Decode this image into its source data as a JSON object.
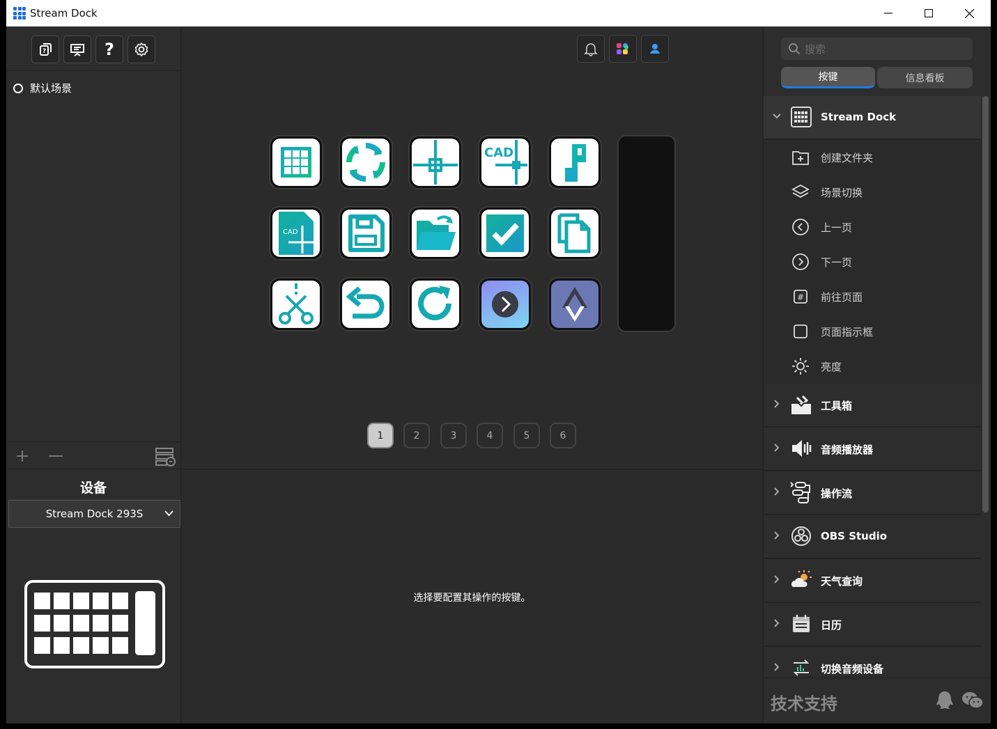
{
  "window": {
    "title": "Stream Dock"
  },
  "left": {
    "scene_label": "默认场景",
    "device_title": "设备",
    "device_selected": "Stream Dock 293S"
  },
  "center": {
    "pages": [
      "1",
      "2",
      "3",
      "4",
      "5",
      "6"
    ],
    "active_page": "1",
    "hint": "选择要配置其操作的按键。",
    "keys": [
      {
        "icon": "grid-icon"
      },
      {
        "icon": "refresh-ring-icon"
      },
      {
        "icon": "crosshair-icon"
      },
      {
        "icon": "cad-crosshair-icon",
        "text": "CAD"
      },
      {
        "icon": "flag-icon"
      },
      {
        "icon": "cad-file-icon",
        "text": "CAD"
      },
      {
        "icon": "save-icon"
      },
      {
        "icon": "open-folder-icon"
      },
      {
        "icon": "check-icon"
      },
      {
        "icon": "copy-icon"
      },
      {
        "icon": "scissors-icon"
      },
      {
        "icon": "undo-icon"
      },
      {
        "icon": "redo-icon"
      },
      {
        "icon": "next-page-icon"
      },
      {
        "icon": "page-up-down-icon"
      }
    ]
  },
  "right": {
    "search_placeholder": "搜索",
    "tabs": [
      "按键",
      "信息看板"
    ],
    "active_tab": "按键",
    "categories": [
      {
        "label": "Stream Dock",
        "expanded": true,
        "icon": "keypad-icon"
      },
      {
        "label": "工具箱",
        "icon": "toolbox-icon"
      },
      {
        "label": "音频播放器",
        "icon": "speaker-icon"
      },
      {
        "label": "操作流",
        "icon": "workflow-icon"
      },
      {
        "label": "OBS Studio",
        "icon": "obs-icon"
      },
      {
        "label": "天气查询",
        "icon": "weather-icon"
      },
      {
        "label": "日历",
        "icon": "calendar-icon"
      },
      {
        "label": "切换音频设备",
        "icon": "audio-device-icon"
      }
    ],
    "streamdock_items": [
      {
        "label": "创建文件夹",
        "icon": "folder-add-icon"
      },
      {
        "label": "场景切换",
        "icon": "layers-icon"
      },
      {
        "label": "上一页",
        "icon": "prev-circle-icon"
      },
      {
        "label": "下一页",
        "icon": "next-circle-icon"
      },
      {
        "label": "前往页面",
        "icon": "hash-icon"
      },
      {
        "label": "页面指示框",
        "icon": "square-icon"
      },
      {
        "label": "亮度",
        "icon": "sun-icon"
      }
    ],
    "support_label": "技术支持"
  },
  "colors": {
    "accent": "#1f7ae0",
    "teal": "#17b8a6",
    "key_gradient": "#00a0a0"
  }
}
